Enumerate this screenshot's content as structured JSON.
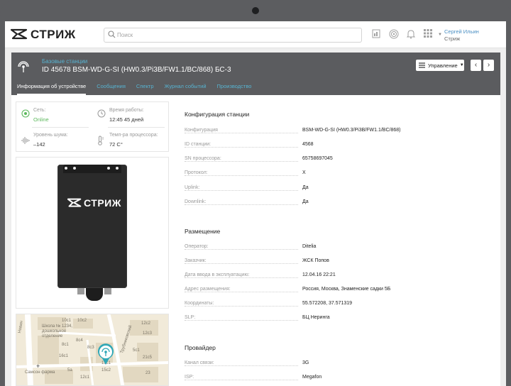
{
  "app": {
    "logo_text": "СТРИЖ"
  },
  "search": {
    "placeholder": "Поиск"
  },
  "toolbar_icons": [
    "report-icon",
    "station-icon",
    "bell-icon",
    "apps-grid-icon"
  ],
  "user": {
    "name": "Сергей Ильин",
    "org": "Стриж"
  },
  "header": {
    "breadcrumb": "Базовые станции",
    "title": "ID 45678  BSM-WD-G-SI (HW0.3/Pi3B/FW1.1/BC/868) БС-3",
    "manage_label": "Управление",
    "prev_label": "‹",
    "next_label": "›",
    "tabs": [
      {
        "label": "Информация об устройстве",
        "active": true
      },
      {
        "label": "Сообщения",
        "active": false
      },
      {
        "label": "Спектр",
        "active": false
      },
      {
        "label": "Журнал событий",
        "active": false
      },
      {
        "label": "Производство",
        "active": false
      }
    ]
  },
  "status": {
    "network": {
      "label": "Сеть:",
      "value": "Online"
    },
    "uptime": {
      "label": "Время работы:",
      "value": "12:45 45 дней"
    },
    "noise": {
      "label": "Уровень шума:",
      "value": "–142"
    },
    "cpu_temp": {
      "label": "Темп-ра процессора:",
      "value": "72 C°"
    }
  },
  "device": {
    "logo_text": "СТРИЖ"
  },
  "map": {
    "labels": [
      "Новин",
      "Школа № 1234,",
      "дошкольное",
      "отделение",
      "Самсон фарма",
      "Трубниковский",
      "10с1",
      "10с2",
      "8с1",
      "8с4",
      "8с3",
      "16с1",
      "15с1",
      "15с2",
      "12с2",
      "12с3",
      "5с1",
      "21с5",
      "23",
      "12с1",
      "5а"
    ]
  },
  "config": {
    "station": {
      "title": "Конфигурация станции",
      "rows": [
        {
          "label": "Конфигурация",
          "value": "BSM-WD-G-SI (HW0.3/Pi3B/FW1.1/BC/868)"
        },
        {
          "label": "ID станции:",
          "value": "4568"
        },
        {
          "label": "SN процессора:",
          "value": "65758697045"
        },
        {
          "label": "Протокол:",
          "value": "X"
        },
        {
          "label": "Uplink:",
          "value": "Да"
        },
        {
          "label": "Downlink:",
          "value": "Да"
        }
      ]
    },
    "placement": {
      "title": "Размещение",
      "rows": [
        {
          "label": "Оператор:",
          "value": "Ditelia"
        },
        {
          "label": "Заказчик:",
          "value": "ЖСК Попов"
        },
        {
          "label": "Дата ввода в эксплуатацию:",
          "value": "12.04.16 22:21"
        },
        {
          "label": "Адрес размещения:",
          "value": "Россия, Москва, Знаменские садки 5Б"
        },
        {
          "label": "Координаты:",
          "value": "55.572208, 37.571319"
        },
        {
          "label": "SLP:",
          "value": "БЦ Неринга"
        }
      ]
    },
    "provider": {
      "title": "Провайдер",
      "rows": [
        {
          "label": "Канал связи:",
          "value": "3G"
        },
        {
          "label": "ISP:",
          "value": "Megafon"
        }
      ]
    }
  },
  "colors": {
    "accent": "#57b3d1",
    "online": "#5cb85c",
    "band": "#5b5c5f",
    "marker": "#2fa7b6"
  }
}
